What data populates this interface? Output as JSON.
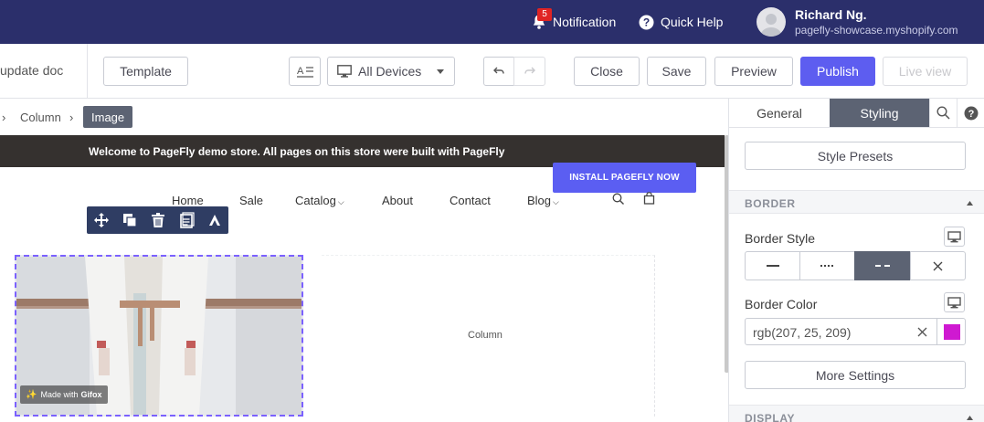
{
  "topbar": {
    "notification_count": "5",
    "notification_label": "Notification",
    "quick_help_label": "Quick Help",
    "user_name": "Richard Ng.",
    "user_store": "pagefly-showcase.myshopify.com"
  },
  "toolbar": {
    "page_title": "update doc",
    "template_label": "Template",
    "devices_label": "All Devices",
    "close_label": "Close",
    "save_label": "Save",
    "preview_label": "Preview",
    "publish_label": "Publish",
    "live_view_label": "Live view"
  },
  "breadcrumb": {
    "items": [
      "Column",
      "Image"
    ]
  },
  "canvas": {
    "announcement": "Welcome to PageFly demo store. All pages on this store were built with PageFly",
    "install_label": "INSTALL PAGEFLY NOW",
    "nav": [
      "Home",
      "Sale",
      "Catalog",
      "About",
      "Contact",
      "Blog"
    ],
    "image_watermark": "Made with",
    "image_watermark_brand": "Gifox",
    "column_label": "Column"
  },
  "panel": {
    "tabs": [
      "General",
      "Styling"
    ],
    "active_tab": "Styling",
    "style_presets_label": "Style Presets",
    "border_section": "BORDER",
    "border_style_label": "Border Style",
    "border_color_label": "Border Color",
    "border_color_value": "rgb(207, 25, 209)",
    "border_color_hex": "#cf19d1",
    "more_settings_label": "More Settings",
    "display_section": "DISPLAY"
  },
  "colors": {
    "topbar_bg": "#2b2f6b",
    "accent": "#5d5df0",
    "active_tab_bg": "#5c6373"
  }
}
